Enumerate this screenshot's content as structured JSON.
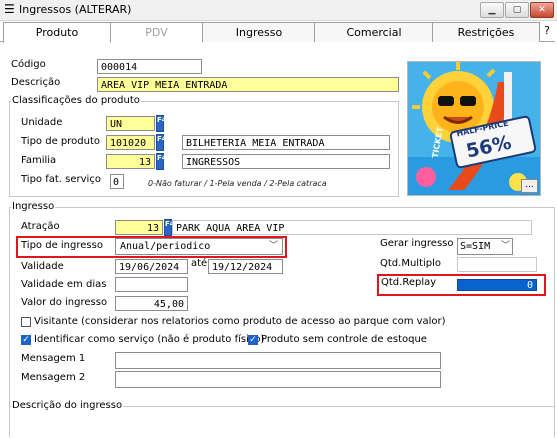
{
  "window": {
    "title": "Ingressos (ALTERAR)",
    "menu_icon": "window-menu-icon",
    "help_label": "?"
  },
  "tabs": [
    {
      "label": "Produto",
      "state": "active"
    },
    {
      "label": "PDV",
      "state": "disabled"
    },
    {
      "label": "Ingresso",
      "state": "inactive"
    },
    {
      "label": "Comercial",
      "state": "inactive"
    },
    {
      "label": "Restrições",
      "state": "inactive"
    }
  ],
  "product": {
    "codigo_label": "Código",
    "codigo_value": "000014",
    "descricao_label": "Descrição",
    "descricao_value": "AREA VIP MEIA ENTRADA"
  },
  "classificacoes": {
    "group_label": "Classificações do produto",
    "unidade_label": "Unidade",
    "unidade_value": "UN",
    "tipo_produto_label": "Tipo de produto",
    "tipo_produto_code": "101020",
    "tipo_produto_desc": "BILHETERIA MEIA ENTRADA",
    "familia_label": "Familia",
    "familia_code": "13",
    "familia_desc": "INGRESSOS",
    "tipo_fat_label": "Tipo fat. serviço",
    "tipo_fat_value": "0",
    "tipo_fat_hint": "0-Não faturar / 1-Pela venda / 2-Pela catraca",
    "lookup_button": "F4"
  },
  "promo_image": {
    "badge_text_1": "HALF-PRICE",
    "badge_text_2": "56%",
    "side_text": "TICKET",
    "more_button": "...",
    "colors": {
      "sky": "#45b3ea",
      "sun": "#ffc21f",
      "slide": "#e84a1c"
    }
  },
  "ingresso": {
    "group_label": "Ingresso",
    "atracao_label": "Atração",
    "atracao_code": "13",
    "atracao_desc": "PARK AQUA AREA VIP",
    "tipo_ingresso_label": "Tipo de ingresso",
    "tipo_ingresso_value": "Anual/periodico",
    "gerar_label": "Gerar ingresso",
    "gerar_value": "S=SIM",
    "validade_label": "Validade",
    "validade_de": "19/06/2024",
    "validade_ate_label": "até",
    "validade_ate": "19/12/2024",
    "qtd_multiplo_label": "Qtd.Multiplo",
    "qtd_multiplo_value": "",
    "validade_dias_label": "Validade em dias",
    "validade_dias_value": "",
    "qtd_replay_label": "Qtd.Replay",
    "qtd_replay_value": "0",
    "valor_label": "Valor do ingresso",
    "valor_value": "45,00",
    "visitante_label": "Visitante (considerar nos relatorios como produto de acesso ao parque com valor)",
    "visitante_checked": false,
    "identificar_label": "Identificar como serviço (não é produto físico)",
    "identificar_checked": true,
    "sem_estoque_label": "Produto sem controle de estoque",
    "sem_estoque_checked": true,
    "mensagem1_label": "Mensagem 1",
    "mensagem1_value": "",
    "mensagem2_label": "Mensagem 2",
    "mensagem2_value": "",
    "descricao_ingresso_label": "Descrição do ingresso"
  },
  "colors": {
    "highlight_red": "#e0161f",
    "yellow_field": "#ffff99",
    "accent_blue": "#0a62d0"
  }
}
